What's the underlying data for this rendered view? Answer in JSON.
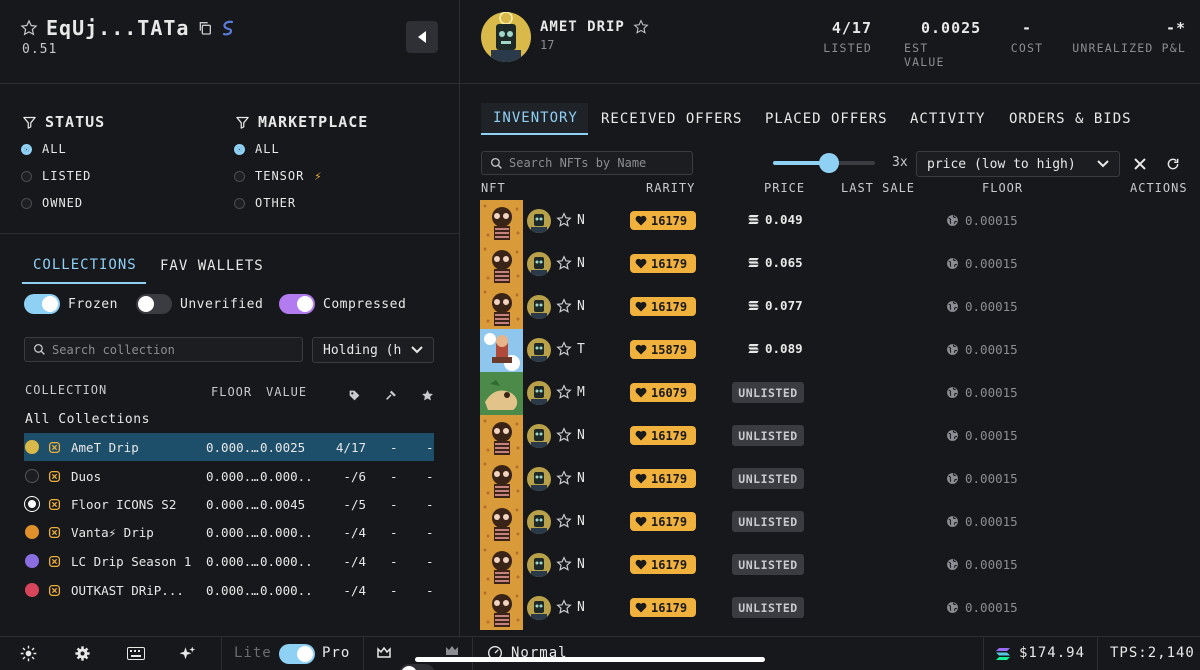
{
  "wallet": {
    "title": "EqUj...TATa",
    "balance": "0.51"
  },
  "filters": {
    "status": {
      "label": "STATUS",
      "options": [
        "ALL",
        "LISTED",
        "OWNED"
      ],
      "selected": "ALL"
    },
    "marketplace": {
      "label": "MARKETPLACE",
      "options": [
        "ALL",
        "TENSOR",
        "OTHER"
      ],
      "tensor_glyph": "⚡",
      "selected": "ALL"
    }
  },
  "left_tabs": [
    "COLLECTIONS",
    "FAV WALLETS"
  ],
  "toggles": [
    {
      "label": "Frozen",
      "state": "on",
      "color": "#8fd0f5"
    },
    {
      "label": "Unverified",
      "state": "off",
      "color": "#3a3c42"
    },
    {
      "label": "Compressed",
      "state": "on",
      "color": "#b27bf0"
    }
  ],
  "collection_search": {
    "placeholder": "Search collection",
    "sort_value": "Holding (h"
  },
  "collections_table": {
    "headers": [
      "COLLECTION",
      "FLOOR",
      "VALUE"
    ],
    "all_label": "All Collections",
    "rows": [
      {
        "name": "AmeT Drip",
        "floor": "0.000...",
        "value": "0.0025",
        "listed": "4/17",
        "d1": "-",
        "d2": "-",
        "selected": true
      },
      {
        "name": "Duos",
        "floor": "0.000...",
        "value": "0.000...",
        "listed": "-/6",
        "d1": "-",
        "d2": "-",
        "selected": false
      },
      {
        "name": "Floor ICONS S2",
        "floor": "0.000...",
        "value": "0.0045",
        "listed": "-/5",
        "d1": "-",
        "d2": "-",
        "selected": false
      },
      {
        "name": "Vanta⚡ Drip",
        "floor": "0.000...",
        "value": "0.000...",
        "listed": "-/4",
        "d1": "-",
        "d2": "-",
        "selected": false
      },
      {
        "name": "LC Drip Season 1",
        "floor": "0.000...",
        "value": "0.000...",
        "listed": "-/4",
        "d1": "-",
        "d2": "-",
        "selected": false
      },
      {
        "name": "OUTKAST DRiP...",
        "floor": "0.000...",
        "value": "0.000...",
        "listed": "-/4",
        "d1": "-",
        "d2": "-",
        "selected": false
      }
    ]
  },
  "collection_header": {
    "name": "AMET DRIP",
    "count": "17",
    "stats": [
      {
        "value": "4/17",
        "label": "LISTED"
      },
      {
        "value": "0.0025",
        "label": "EST VALUE"
      },
      {
        "value": "-",
        "label": "COST"
      },
      {
        "value": "-*",
        "label": "UNREALIZED P&L"
      }
    ]
  },
  "right_tabs": [
    "INVENTORY",
    "RECEIVED OFFERS",
    "PLACED OFFERS",
    "ACTIVITY",
    "ORDERS & BIDS"
  ],
  "active_right_tab": "INVENTORY",
  "nft_search": {
    "placeholder": "Search NFTs by Name",
    "zoom": "3x",
    "zoom_level": 0.55,
    "sort": "price (low to high)"
  },
  "nft_table": {
    "headers": [
      "NFT",
      "RARITY",
      "PRICE",
      "LAST SALE",
      "FLOOR",
      "ACTIONS"
    ],
    "rows": [
      {
        "letter": "N",
        "rarity": "16179",
        "price": "0.049",
        "listed": true,
        "floor": "0.00015",
        "art": "drip"
      },
      {
        "letter": "N",
        "rarity": "16179",
        "price": "0.065",
        "listed": true,
        "floor": "0.00015",
        "art": "drip"
      },
      {
        "letter": "N",
        "rarity": "16179",
        "price": "0.077",
        "listed": true,
        "floor": "0.00015",
        "art": "drip"
      },
      {
        "letter": "T",
        "rarity": "15879",
        "price": "0.089",
        "listed": true,
        "floor": "0.00015",
        "art": "sky"
      },
      {
        "letter": "M",
        "rarity": "16079",
        "price": "UNLISTED",
        "listed": false,
        "floor": "0.00015",
        "art": "green"
      },
      {
        "letter": "N",
        "rarity": "16179",
        "price": "UNLISTED",
        "listed": false,
        "floor": "0.00015",
        "art": "drip"
      },
      {
        "letter": "N",
        "rarity": "16179",
        "price": "UNLISTED",
        "listed": false,
        "floor": "0.00015",
        "art": "drip"
      },
      {
        "letter": "N",
        "rarity": "16179",
        "price": "UNLISTED",
        "listed": false,
        "floor": "0.00015",
        "art": "drip"
      },
      {
        "letter": "N",
        "rarity": "16179",
        "price": "UNLISTED",
        "listed": false,
        "floor": "0.00015",
        "art": "drip"
      },
      {
        "letter": "N",
        "rarity": "16179",
        "price": "UNLISTED",
        "listed": false,
        "floor": "0.00015",
        "art": "drip"
      }
    ]
  },
  "bottom_bar": {
    "lite_label": "Lite",
    "pro_label": "Pro",
    "mode_label": "Normal",
    "sol_price": "$174.94",
    "tps": "TPS:2,140"
  },
  "colors": {
    "accent": "#8fd0f5",
    "rarity_badge": "#f0b23c",
    "selected_row": "#1d4f6b",
    "background": "#17181b"
  }
}
